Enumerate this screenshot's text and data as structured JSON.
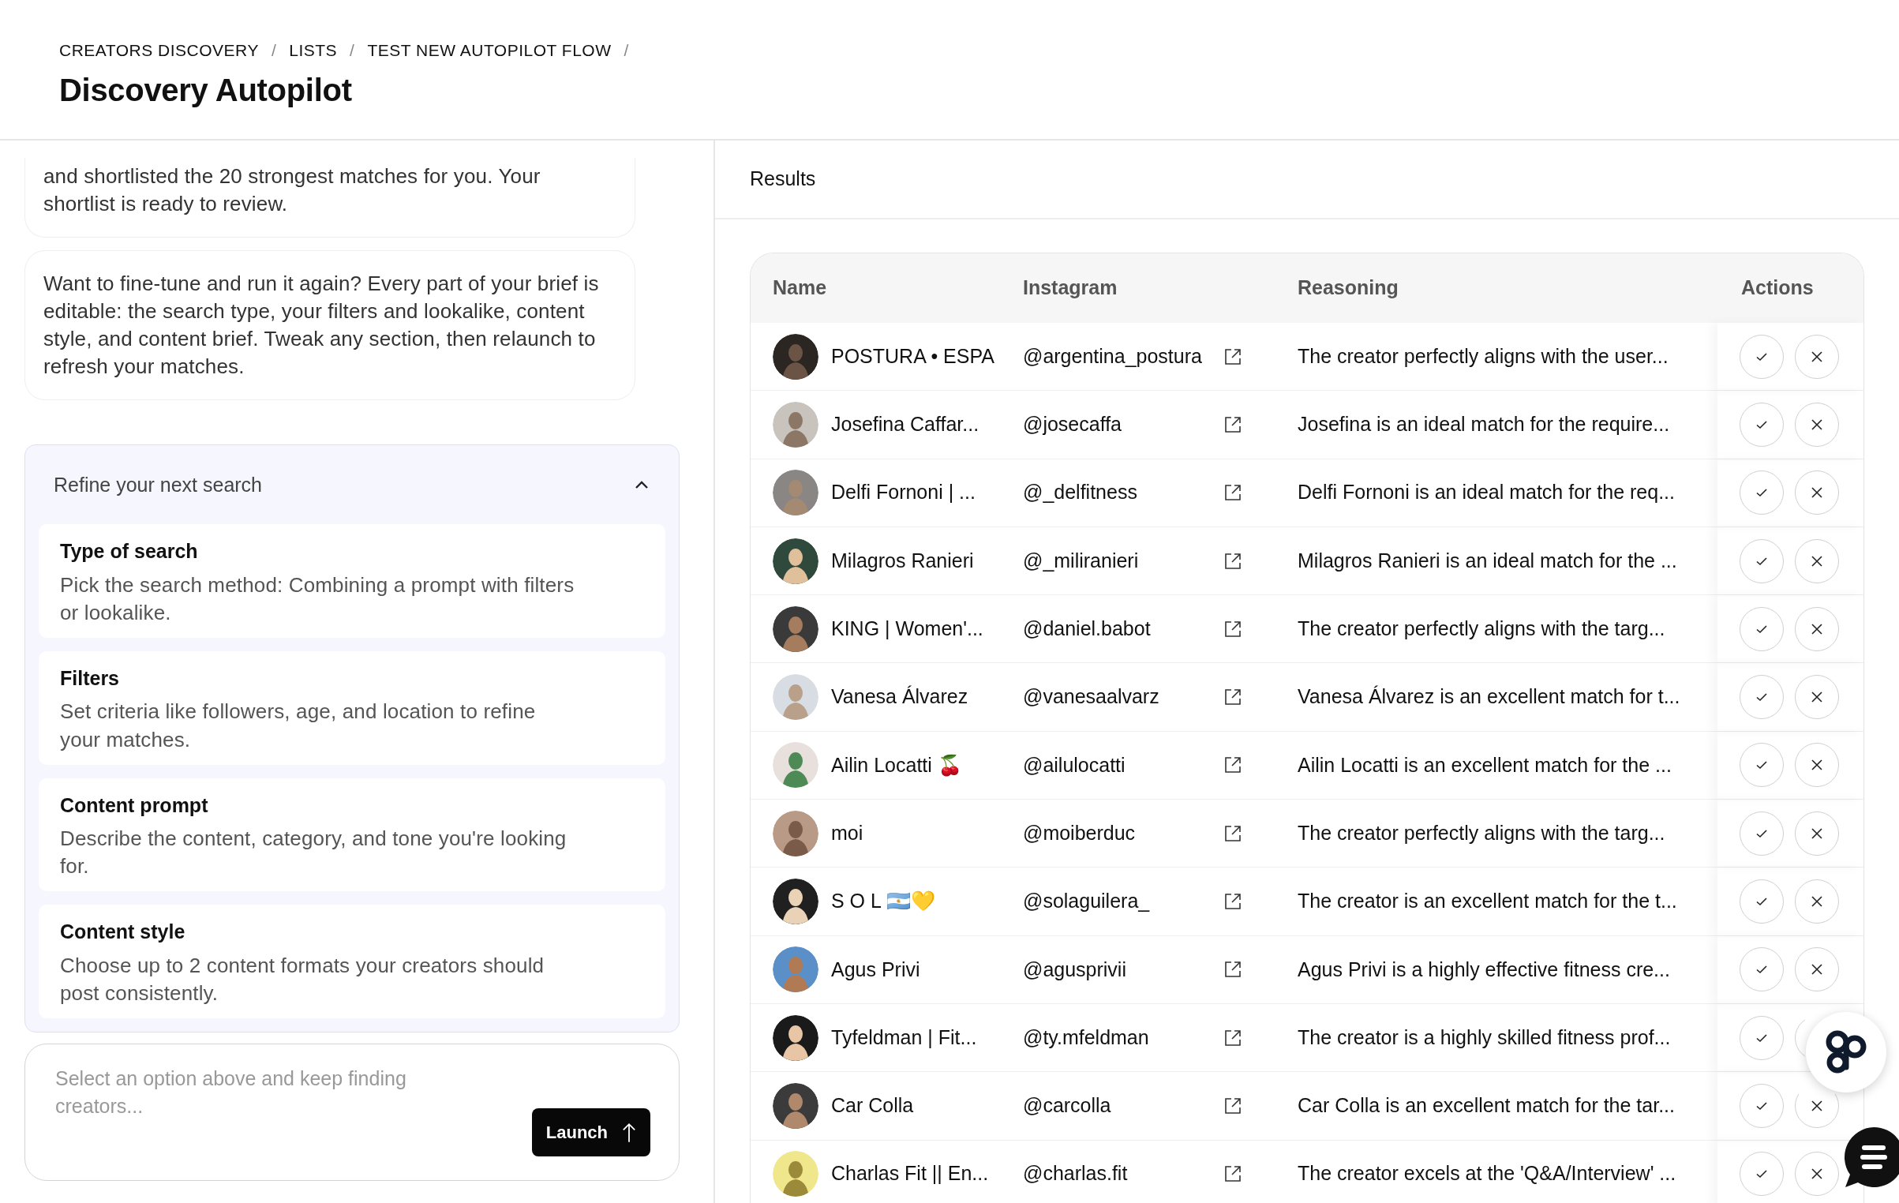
{
  "breadcrumb": {
    "separator": "/",
    "items": [
      {
        "label": "CREATORS DISCOVERY"
      },
      {
        "label": "LISTS"
      },
      {
        "label": "TEST NEW AUTOPILOT FLOW"
      }
    ]
  },
  "title": "Discovery Autopilot",
  "messages": [
    {
      "text": "and shortlisted the 20 strongest matches for you. Your shortlist is ready to review."
    },
    {
      "text": "Want to fine-tune and run it again? Every part of your brief is editable: the search type, your filters and lookalike, content style, and content brief. Tweak any section, then relaunch to refresh your matches."
    }
  ],
  "refine": {
    "title": "Refine your next search",
    "expanded": true,
    "options": [
      {
        "title": "Type of search",
        "description": "Pick the search method: Combining a prompt with filters or lookalike."
      },
      {
        "title": "Filters",
        "description": "Set criteria like followers, age, and location to refine your matches."
      },
      {
        "title": "Content prompt",
        "description": "Describe the content, category, and tone you're looking for."
      },
      {
        "title": "Content style",
        "description": "Choose up to 2 content formats your creators should post consistently."
      }
    ]
  },
  "composer": {
    "placeholder": "Select an option above and keep finding creators...",
    "button": "Launch"
  },
  "results": {
    "title": "Results",
    "columns": [
      "Name",
      "Instagram",
      "Reasoning",
      "Actions"
    ],
    "rows": [
      {
        "name": "POSTURA • ESPA",
        "handle": "@argentina_postura",
        "reasoning": "The creator perfectly aligns with the user..."
      },
      {
        "name": "Josefina Caffar...",
        "handle": "@josecaffa",
        "reasoning": "Josefina is an ideal match for the require..."
      },
      {
        "name": "Delfi Fornoni | ...",
        "handle": "@_delfitness",
        "reasoning": "Delfi Fornoni is an ideal match for the req..."
      },
      {
        "name": "Milagros Ranieri",
        "handle": "@_miliranieri",
        "reasoning": "Milagros Ranieri is an ideal match for the ..."
      },
      {
        "name": "KING | Women'...",
        "handle": "@daniel.babot",
        "reasoning": "The creator perfectly aligns with the targ..."
      },
      {
        "name": "Vanesa Álvarez",
        "handle": "@vanesaalvarz",
        "reasoning": "Vanesa Álvarez is an excellent match for t..."
      },
      {
        "name": "Ailin Locatti 🍒",
        "handle": "@ailulocatti",
        "reasoning": "Ailin Locatti is an excellent match for the ..."
      },
      {
        "name": "moi",
        "handle": "@moiberduc",
        "reasoning": "The creator perfectly aligns with the targ..."
      },
      {
        "name": "S O L 🇦🇷💛",
        "handle": "@solaguilera_",
        "reasoning": "The creator is an excellent match for the t..."
      },
      {
        "name": "Agus Privi",
        "handle": "@agusprivii",
        "reasoning": "Agus Privi is a highly effective fitness cre..."
      },
      {
        "name": "Tyfeldman | Fit...",
        "handle": "@ty.mfeldman",
        "reasoning": "The creator is a highly skilled fitness prof..."
      },
      {
        "name": "Car Colla",
        "handle": "@carcolla",
        "reasoning": "Car Colla is an excellent match for the tar..."
      },
      {
        "name": "Charlas Fit || En...",
        "handle": "@charlas.fit",
        "reasoning": "The creator excels at the 'Q&A/Interview' ..."
      }
    ]
  }
}
